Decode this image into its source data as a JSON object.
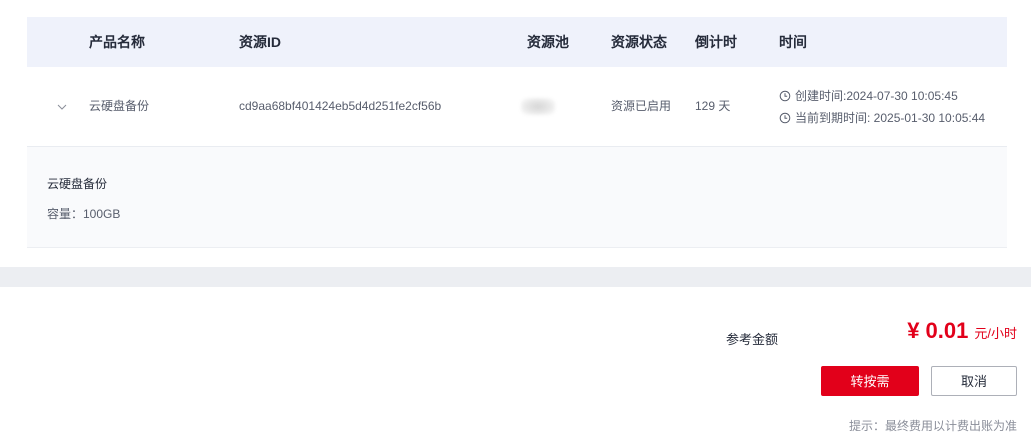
{
  "table": {
    "headers": {
      "product_name": "产品名称",
      "resource_id": "资源ID",
      "resource_pool": "资源池",
      "resource_status": "资源状态",
      "countdown": "倒计时",
      "time": "时间"
    },
    "row": {
      "product_name": "云硬盘备份",
      "resource_id": "cd9aa68bf401424eb5d4d251fe2cf56b",
      "resource_pool": "",
      "resource_status": "资源已启用",
      "countdown": "129 天",
      "created_time": "创建时间:2024-07-30 10:05:45",
      "expire_time": "当前到期时间: 2025-01-30 10:05:44"
    },
    "detail": {
      "title": "云硬盘备份",
      "capacity": "容量：100GB"
    }
  },
  "footer": {
    "price_label": "参考金额",
    "price_amount": "¥ 0.01",
    "price_unit": "元/小时",
    "confirm_button": "转按需",
    "cancel_button": "取消",
    "hint": "提示：最终费用以计费出账为准"
  },
  "icons": {
    "expand": "chevron-down-icon",
    "time": "clock-icon"
  },
  "colors": {
    "accent": "#e2001a",
    "header_bg": "#eff2fb",
    "detail_bg": "#f9fafc",
    "band_bg": "#eceef2",
    "muted_text": "#8a8e99"
  }
}
